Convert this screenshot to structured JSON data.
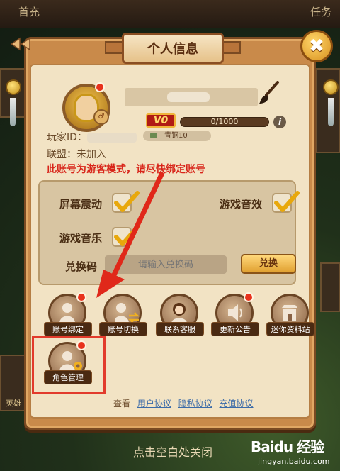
{
  "background": {
    "tab_left": "首充",
    "tab_right": "任务",
    "edge_label": "英雄"
  },
  "dialog": {
    "title": "个人信息",
    "close_glyph": "✖"
  },
  "profile": {
    "vip_level": "V0",
    "exp_text": "0/1000",
    "exp_progress": 0,
    "rank": "青铜10",
    "player_id_label": "玩家ID：",
    "league_text": "联盟：未加入",
    "guest_warning": "此账号为游客模式，请尽快绑定账号"
  },
  "settings": {
    "screen_shake": {
      "label": "屏幕震动",
      "checked": true
    },
    "game_sfx": {
      "label": "游戏音效",
      "checked": true
    },
    "game_music": {
      "label": "游戏音乐",
      "checked": true
    },
    "redeem_label": "兑换码",
    "redeem_placeholder": "请输入兑换码",
    "redeem_button": "兑换"
  },
  "functions": [
    {
      "label": "账号绑定",
      "icon": "person-icon",
      "badge": true
    },
    {
      "label": "账号切换",
      "icon": "switch-account-icon",
      "badge": false
    },
    {
      "label": "联系客服",
      "icon": "support-agent-icon",
      "badge": false
    },
    {
      "label": "更新公告",
      "icon": "speaker-icon",
      "badge": true
    },
    {
      "label": "迷你资料站",
      "icon": "building-icon",
      "badge": false
    },
    {
      "label": "角色管理",
      "icon": "role-gear-icon",
      "badge": true
    }
  ],
  "footer": {
    "prefix": "查看",
    "links": [
      "用户协议",
      "隐私协议",
      "充值协议"
    ]
  },
  "dismiss_hint": "点击空白处关闭",
  "watermark": {
    "brand": "Baidu 经验",
    "url": "jingyan.baidu.com"
  },
  "colors": {
    "warning": "#d8251a",
    "highlight": "#e23b2c",
    "link": "#3a6aa8"
  }
}
